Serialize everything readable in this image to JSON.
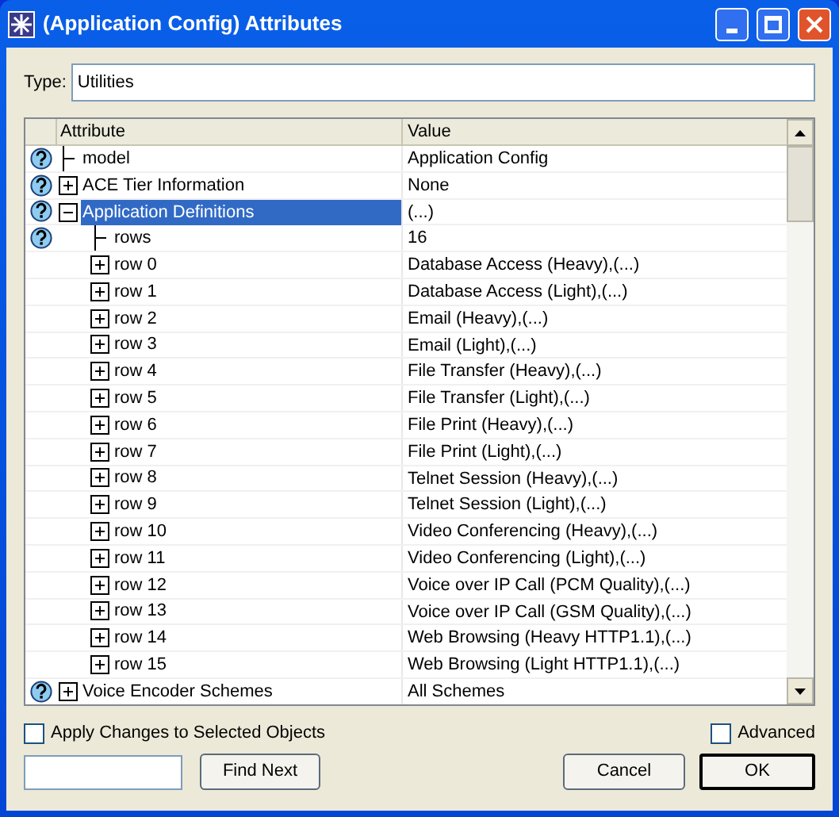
{
  "window": {
    "title": "(Application Config) Attributes"
  },
  "type_field": {
    "label": "Type:",
    "value": "Utilities"
  },
  "table": {
    "columns": [
      "Attribute",
      "Value"
    ],
    "rows": [
      {
        "attribute": "model",
        "value": "Application Config",
        "help": true,
        "kind": "leaf",
        "selected": false
      },
      {
        "attribute": "ACE Tier Information",
        "value": "None",
        "help": true,
        "kind": "node",
        "expanded": false,
        "selected": false
      },
      {
        "attribute": "Application Definitions",
        "value": "(...)",
        "help": true,
        "kind": "node",
        "expanded": true,
        "selected": true,
        "children": [
          {
            "attribute": "rows",
            "value": "16",
            "help": true,
            "kind": "leaf",
            "selected": false
          },
          {
            "attribute": "row 0",
            "value": "Database Access (Heavy),(...)",
            "help": false,
            "kind": "node",
            "expanded": false,
            "selected": false
          },
          {
            "attribute": "row 1",
            "value": "Database Access (Light),(...)",
            "help": false,
            "kind": "node",
            "expanded": false,
            "selected": false
          },
          {
            "attribute": "row 2",
            "value": "Email (Heavy),(...)",
            "help": false,
            "kind": "node",
            "expanded": false,
            "selected": false
          },
          {
            "attribute": "row 3",
            "value": "Email (Light),(...)",
            "help": false,
            "kind": "node",
            "expanded": false,
            "selected": false
          },
          {
            "attribute": "row 4",
            "value": "File Transfer (Heavy),(...)",
            "help": false,
            "kind": "node",
            "expanded": false,
            "selected": false
          },
          {
            "attribute": "row 5",
            "value": "File Transfer (Light),(...)",
            "help": false,
            "kind": "node",
            "expanded": false,
            "selected": false
          },
          {
            "attribute": "row 6",
            "value": "File Print (Heavy),(...)",
            "help": false,
            "kind": "node",
            "expanded": false,
            "selected": false
          },
          {
            "attribute": "row 7",
            "value": "File Print (Light),(...)",
            "help": false,
            "kind": "node",
            "expanded": false,
            "selected": false
          },
          {
            "attribute": "row 8",
            "value": "Telnet Session (Heavy),(...)",
            "help": false,
            "kind": "node",
            "expanded": false,
            "selected": false
          },
          {
            "attribute": "row 9",
            "value": "Telnet Session (Light),(...)",
            "help": false,
            "kind": "node",
            "expanded": false,
            "selected": false
          },
          {
            "attribute": "row 10",
            "value": "Video Conferencing (Heavy),(...)",
            "help": false,
            "kind": "node",
            "expanded": false,
            "selected": false
          },
          {
            "attribute": "row 11",
            "value": "Video Conferencing (Light),(...)",
            "help": false,
            "kind": "node",
            "expanded": false,
            "selected": false
          },
          {
            "attribute": "row 12",
            "value": "Voice over IP Call (PCM Quality),(...)",
            "help": false,
            "kind": "node",
            "expanded": false,
            "selected": false
          },
          {
            "attribute": "row 13",
            "value": "Voice over IP Call (GSM Quality),(...)",
            "help": false,
            "kind": "node",
            "expanded": false,
            "selected": false
          },
          {
            "attribute": "row 14",
            "value": "Web Browsing (Heavy HTTP1.1),(...)",
            "help": false,
            "kind": "node",
            "expanded": false,
            "selected": false
          },
          {
            "attribute": "row 15",
            "value": "Web Browsing (Light HTTP1.1),(...)",
            "help": false,
            "kind": "node",
            "expanded": false,
            "selected": false
          }
        ]
      },
      {
        "attribute": "Voice Encoder Schemes",
        "value": "All Schemes",
        "help": true,
        "kind": "node",
        "expanded": false,
        "selected": false
      }
    ]
  },
  "apply_checkbox": {
    "label": "Apply Changes to Selected Objects",
    "checked": false
  },
  "advanced_checkbox": {
    "label": "Advanced",
    "checked": false
  },
  "buttons": [
    {
      "label": "Find Next",
      "kind": "find"
    },
    {
      "label": "Cancel",
      "kind": "cancel"
    },
    {
      "label": "OK",
      "kind": "ok"
    }
  ]
}
